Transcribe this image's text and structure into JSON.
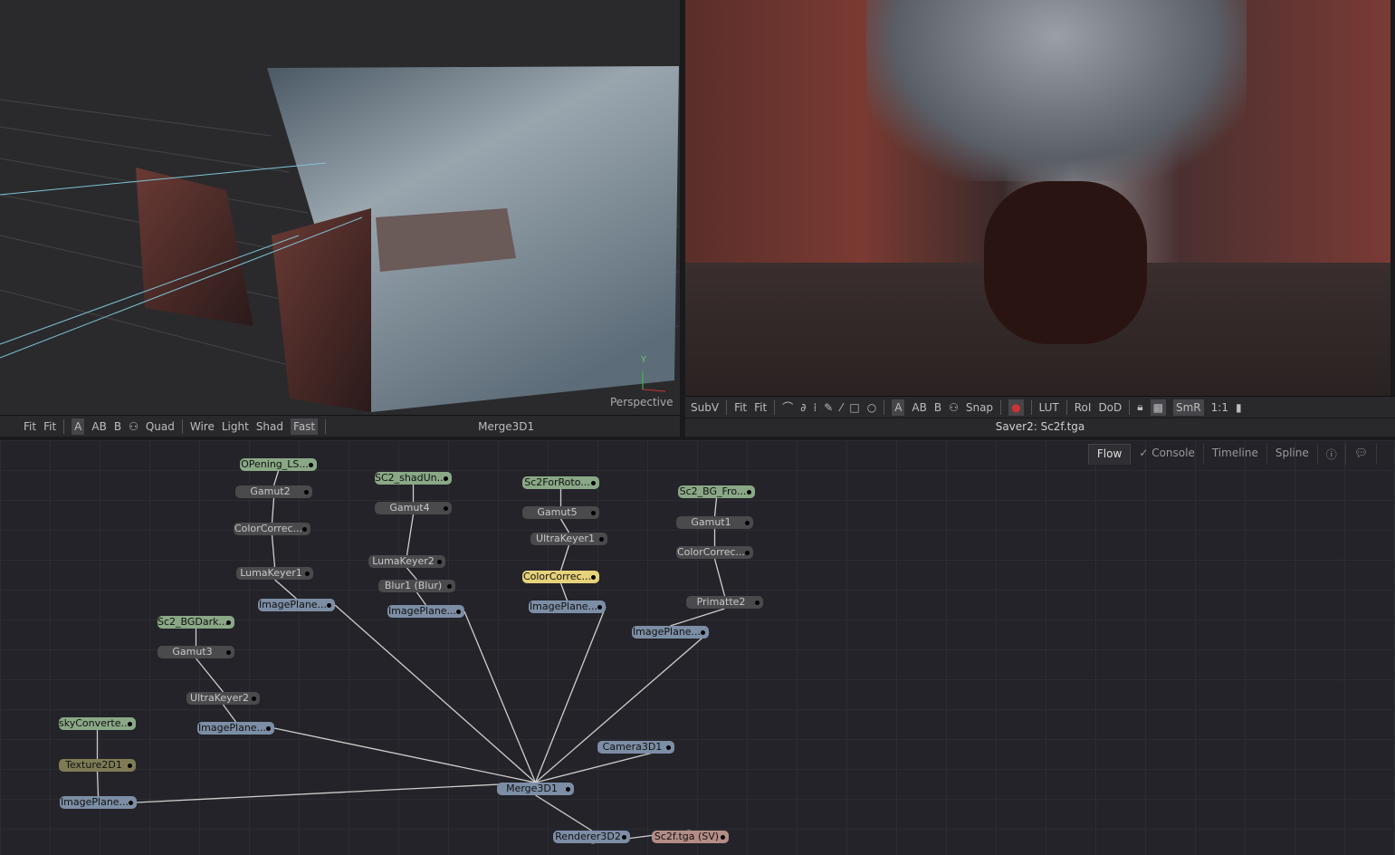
{
  "viewer_left": {
    "toolbar": [
      "Fit",
      "Fit",
      "A",
      "AB",
      "B",
      "Quad",
      "Wire",
      "Light",
      "Shad",
      "Fast"
    ],
    "active": [
      "A",
      "Fast"
    ],
    "title": "Merge3D1",
    "overlay": "Perspective",
    "axis_label": "Y"
  },
  "viewer_right": {
    "toolbar": [
      "SubV",
      "Fit",
      "Fit",
      "A",
      "AB",
      "B",
      "Snap",
      "LUT",
      "RoI",
      "DoD",
      "SmR",
      "1:1"
    ],
    "title": "Saver2: Sc2f.tga"
  },
  "tabs": [
    {
      "label": "Flow",
      "active": true
    },
    {
      "label": "Console"
    },
    {
      "label": "Timeline"
    },
    {
      "label": "Spline"
    }
  ],
  "node_colors": {
    "loader": "#8aa886",
    "tool": "#4a4a4d",
    "3d": "#7c8ea5",
    "selected": "#e6d27a",
    "texture": "#7f7c55",
    "saver": "#b48c86"
  },
  "nodes": [
    {
      "label": "OPening_LS...",
      "type": "green"
    },
    {
      "label": "Gamut2",
      "type": "dark"
    },
    {
      "label": "ColorCorrec...",
      "type": "dark"
    },
    {
      "label": "LumaKeyer1",
      "type": "dark"
    },
    {
      "label": "ImagePlane...",
      "type": "blue"
    },
    {
      "label": "SC2_shadUn...",
      "type": "green"
    },
    {
      "label": "Gamut4",
      "type": "dark"
    },
    {
      "label": "LumaKeyer2",
      "type": "dark"
    },
    {
      "label": "Blur1  (Blur)",
      "type": "dark"
    },
    {
      "label": "ImagePlane...",
      "type": "blue"
    },
    {
      "label": "Sc2ForRoto...",
      "type": "green"
    },
    {
      "label": "Gamut5",
      "type": "dark"
    },
    {
      "label": "UltraKeyer1",
      "type": "dark"
    },
    {
      "label": "ColorCorrec...",
      "type": "yellow"
    },
    {
      "label": "ImagePlane...",
      "type": "blue"
    },
    {
      "label": "Sc2_BG_Fro...",
      "type": "green"
    },
    {
      "label": "Gamut1",
      "type": "dark"
    },
    {
      "label": "ColorCorrec...",
      "type": "dark"
    },
    {
      "label": "Primatte2",
      "type": "dark"
    },
    {
      "label": "ImagePlane...",
      "type": "blue"
    },
    {
      "label": "Sc2_BGDark...",
      "type": "green"
    },
    {
      "label": "Gamut3",
      "type": "dark"
    },
    {
      "label": "UltraKeyer2",
      "type": "dark"
    },
    {
      "label": "ImagePlane...",
      "type": "blue"
    },
    {
      "label": "skyConverte...",
      "type": "green"
    },
    {
      "label": "Texture2D1",
      "type": "olive"
    },
    {
      "label": "ImagePlane...",
      "type": "blue"
    },
    {
      "label": "Camera3D1",
      "type": "blue"
    },
    {
      "label": "Merge3D1",
      "type": "blue"
    },
    {
      "label": "Renderer3D2",
      "type": "blue"
    },
    {
      "label": "Sc2f.tga  (SV)",
      "type": "pink"
    }
  ]
}
